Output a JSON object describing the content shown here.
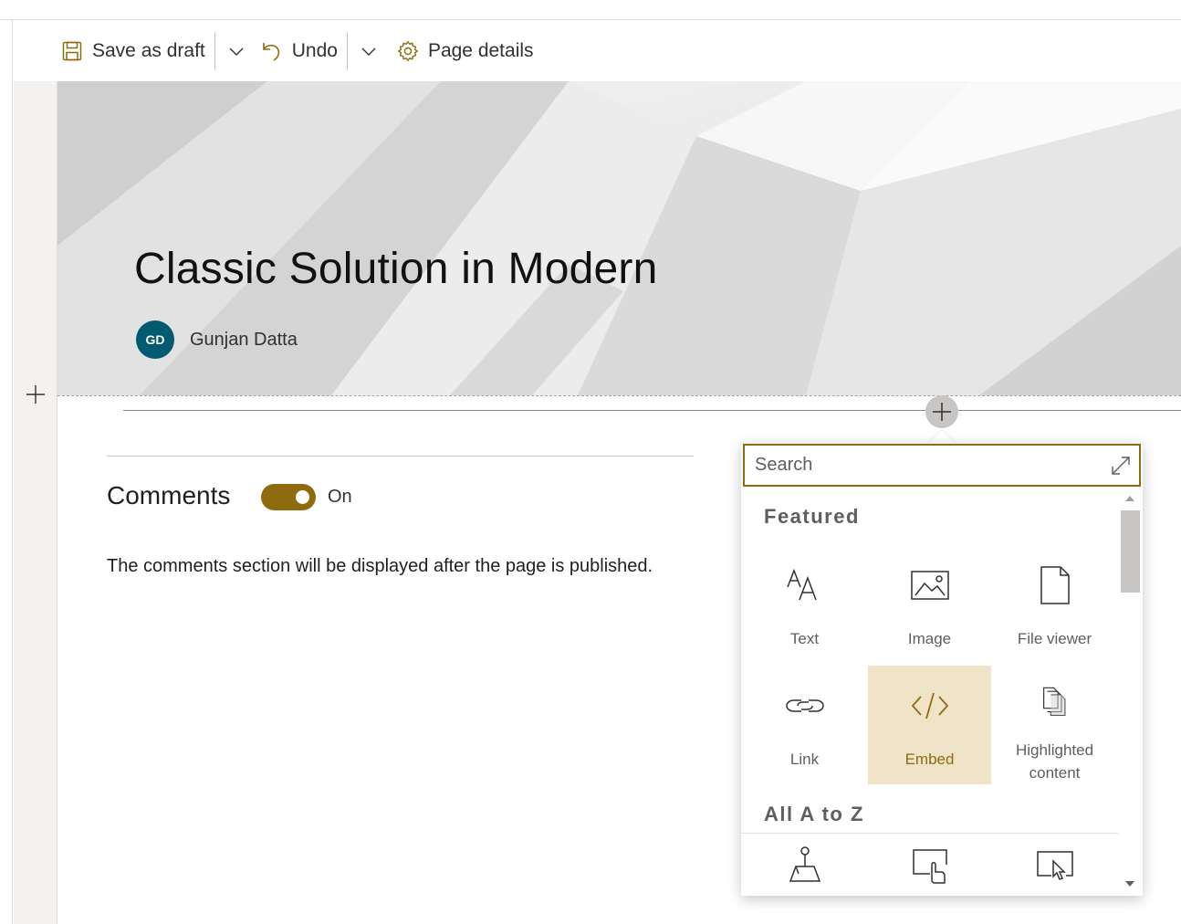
{
  "toolbar": {
    "save_label": "Save as draft",
    "undo_label": "Undo",
    "page_details_label": "Page details"
  },
  "hero": {
    "title": "Classic Solution in Modern",
    "author_initials": "GD",
    "author_name": "Gunjan Datta",
    "avatar_color": "#005b70"
  },
  "comments": {
    "title": "Comments",
    "toggle_state": "On",
    "note": "The comments section will be displayed after the page is published."
  },
  "toolbox": {
    "search_placeholder": "Search",
    "featured_title": "Featured",
    "all_title": "All A to Z",
    "featured_items": [
      {
        "label": "Text",
        "icon": "text-icon"
      },
      {
        "label": "Image",
        "icon": "image-icon"
      },
      {
        "label": "File viewer",
        "icon": "file-icon"
      },
      {
        "label": "Link",
        "icon": "link-icon"
      },
      {
        "label": "Embed",
        "icon": "embed-icon",
        "selected": true
      },
      {
        "label": "Highlighted content",
        "icon": "highlighted-content-icon"
      }
    ],
    "all_items_icons": [
      "map-pin-icon",
      "touch-screen-icon",
      "presentation-cursor-icon"
    ]
  },
  "colors": {
    "accent": "#8f6b0f",
    "selected_tile": "#efe4c7"
  }
}
